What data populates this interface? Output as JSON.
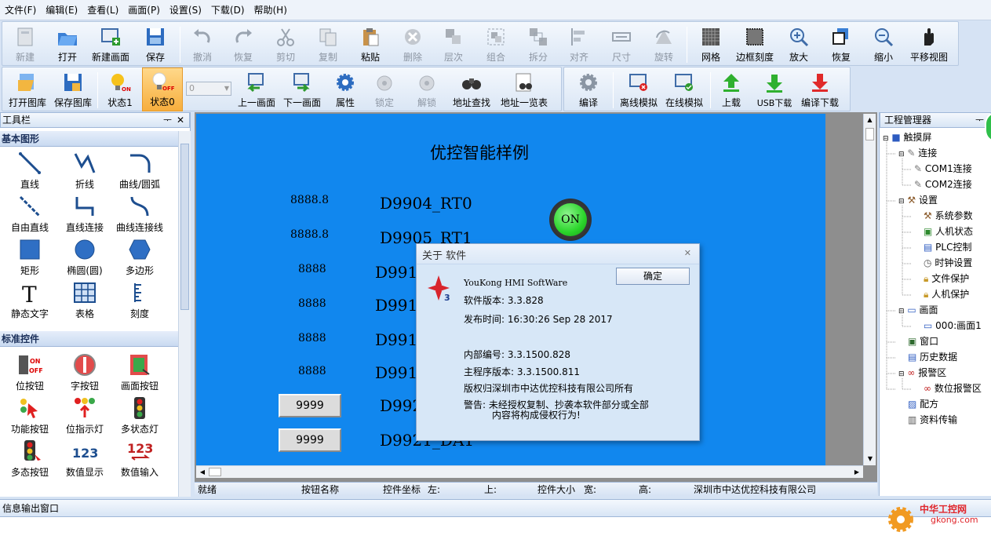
{
  "menu": [
    "文件(F)",
    "编辑(E)",
    "查看(L)",
    "画面(P)",
    "设置(S)",
    "下载(D)",
    "帮助(H)"
  ],
  "toolbar1": [
    "新建",
    "打开",
    "新建画面",
    "保存",
    "撤消",
    "恢复",
    "剪切",
    "复制",
    "粘贴",
    "删除",
    "层次",
    "组合",
    "拆分",
    "对齐",
    "尺寸",
    "旋转",
    "网格",
    "边框刻度",
    "放大",
    "恢复",
    "缩小",
    "平移视图"
  ],
  "toolbar2": [
    "打开图库",
    "保存图库",
    "状态1",
    "状态0",
    "上一画面",
    "下一画面",
    "属性",
    "锁定",
    "解锁",
    "地址查找",
    "地址一览表",
    "编译",
    "离线模拟",
    "在线模拟",
    "上载",
    "USB下载",
    "编译下载"
  ],
  "state_select": "0",
  "toolbox": {
    "title": "工具栏",
    "pin": "ᅮ",
    "close": "✕",
    "cat1": "基本图形",
    "cat2": "标准控件",
    "items1": [
      "直线",
      "折线",
      "曲线/圆弧",
      "自由直线",
      "直线连接",
      "曲线连接线",
      "矩形",
      "椭圆(圆)",
      "多边形",
      "静态文字",
      "表格",
      "刻度"
    ],
    "items2": [
      "位按钮",
      "字按钮",
      "画面按钮",
      "功能按钮",
      "位指示灯",
      "多状态灯",
      "多态按钮",
      "数值显示",
      "数值输入"
    ]
  },
  "canvas": {
    "title": "优控智能样例",
    "nums": [
      "8888.8",
      "8888.8",
      "8888",
      "8888",
      "8888",
      "8888"
    ],
    "boxes": [
      "9999",
      "9999"
    ],
    "labels": [
      "D9904_RT0",
      "D9905_RT1",
      "D991(",
      "D991",
      "D991(",
      "D991",
      "D992",
      "D9921_DA1"
    ],
    "on_label": "ON"
  },
  "dialog": {
    "title": "关于 软件",
    "close": "✕",
    "ok": "确定",
    "logo_num": "3",
    "product": "YouKong HMI SoftWare",
    "version": "软件版本: 3.3.828",
    "release": "发布时间: 16:30:26 Sep 28 2017",
    "internal": "内部编号: 3.3.1500.828",
    "main_version": "主程序版本: 3.3.1500.811",
    "copyright": "版权归深圳市中达优控科技有限公司所有",
    "warning1": "警告: 未经授权复制、抄袭本软件部分或全部",
    "warning2": "内容将构成侵权行为!"
  },
  "status": {
    "ready": "就绪",
    "btn_name": "按钮名称",
    "coord": "控件坐标",
    "left": "左:",
    "top": "上:",
    "size": "控件大小",
    "width": "宽:",
    "height": "高:",
    "company": "深圳市中达优控科技有限公司"
  },
  "project": {
    "title": "工程管理器",
    "pin": "ᅮ",
    "items": [
      "触摸屏",
      "连接",
      "COM1连接",
      "COM2连接",
      "设置",
      "系统参数",
      "人机状态",
      "PLC控制",
      "时钟设置",
      "文件保护",
      "人机保护",
      "画面",
      "000:画面1",
      "窗口",
      "历史数据",
      "报警区",
      "数位报警区",
      "配方",
      "资料传输"
    ]
  },
  "output_title": "信息输出窗口",
  "watermark": {
    "cn": "中华工控网",
    "url": "gkong.com"
  },
  "colors": {
    "canvas_bg": "#1187ee",
    "on_lamp": "#2ad52a",
    "dialog_bg": "#d7e7f7"
  }
}
